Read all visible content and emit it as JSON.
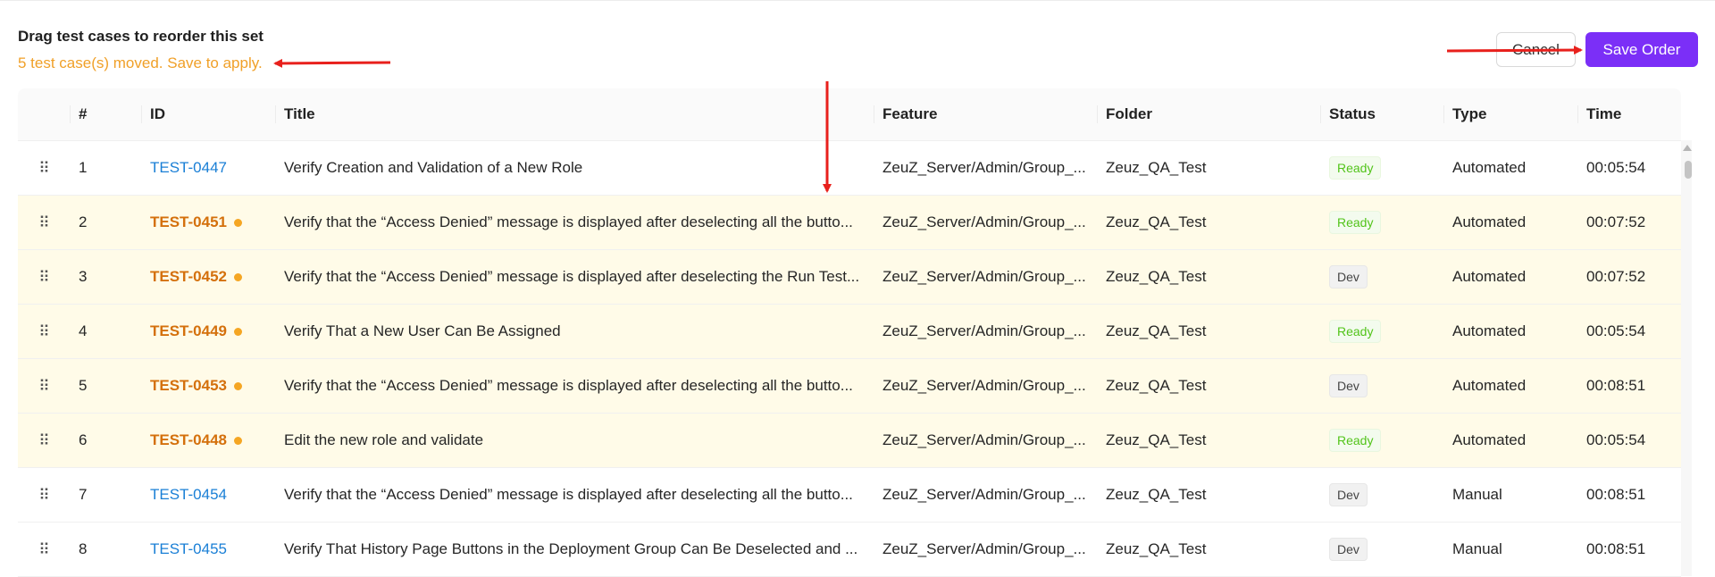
{
  "header": {
    "title": "Drag test cases to reorder this set",
    "moved_notice": "5 test case(s) moved. Save to apply.",
    "cancel_label": "Cancel",
    "save_label": "Save Order"
  },
  "table": {
    "columns": [
      "#",
      "ID",
      "Title",
      "Feature",
      "Folder",
      "Status",
      "Type",
      "Time"
    ],
    "rows": [
      {
        "num": "1",
        "id": "TEST-0447",
        "moved": false,
        "title": "Verify Creation and Validation of a New Role",
        "feature": "ZeuZ_Server/Admin/Group_...",
        "folder": "Zeuz_QA_Test",
        "status": "Ready",
        "type": "Automated",
        "time": "00:05:54"
      },
      {
        "num": "2",
        "id": "TEST-0451",
        "moved": true,
        "title": "Verify that the “Access Denied” message is displayed after deselecting all the butto...",
        "feature": "ZeuZ_Server/Admin/Group_...",
        "folder": "Zeuz_QA_Test",
        "status": "Ready",
        "type": "Automated",
        "time": "00:07:52"
      },
      {
        "num": "3",
        "id": "TEST-0452",
        "moved": true,
        "title": "Verify that the “Access Denied” message is displayed after deselecting the Run Test...",
        "feature": "ZeuZ_Server/Admin/Group_...",
        "folder": "Zeuz_QA_Test",
        "status": "Dev",
        "type": "Automated",
        "time": "00:07:52"
      },
      {
        "num": "4",
        "id": "TEST-0449",
        "moved": true,
        "title": "Verify That a New User Can Be Assigned",
        "feature": "ZeuZ_Server/Admin/Group_...",
        "folder": "Zeuz_QA_Test",
        "status": "Ready",
        "type": "Automated",
        "time": "00:05:54"
      },
      {
        "num": "5",
        "id": "TEST-0453",
        "moved": true,
        "title": "Verify that the “Access Denied” message is displayed after deselecting all the butto...",
        "feature": "ZeuZ_Server/Admin/Group_...",
        "folder": "Zeuz_QA_Test",
        "status": "Dev",
        "type": "Automated",
        "time": "00:08:51"
      },
      {
        "num": "6",
        "id": "TEST-0448",
        "moved": true,
        "title": "Edit the new role and validate",
        "feature": "ZeuZ_Server/Admin/Group_...",
        "folder": "Zeuz_QA_Test",
        "status": "Ready",
        "type": "Automated",
        "time": "00:05:54"
      },
      {
        "num": "7",
        "id": "TEST-0454",
        "moved": false,
        "title": "Verify that the “Access Denied” message is displayed after deselecting all the butto...",
        "feature": "ZeuZ_Server/Admin/Group_...",
        "folder": "Zeuz_QA_Test",
        "status": "Dev",
        "type": "Manual",
        "time": "00:08:51"
      },
      {
        "num": "8",
        "id": "TEST-0455",
        "moved": false,
        "title": "Verify That History Page Buttons in the Deployment Group Can Be Deselected and ...",
        "feature": "ZeuZ_Server/Admin/Group_...",
        "folder": "Zeuz_QA_Test",
        "status": "Dev",
        "type": "Manual",
        "time": "00:08:51"
      }
    ]
  },
  "icons": {
    "drag_handle": "drag-handle-icon",
    "moved_indicator": "moved-dot-icon"
  },
  "colors": {
    "accent": "#7b2ff7",
    "moved_text": "#f0a028",
    "moved_row_bg": "#fffbe8",
    "link": "#1a7fd6",
    "annotation_arrow": "#e8201c"
  }
}
